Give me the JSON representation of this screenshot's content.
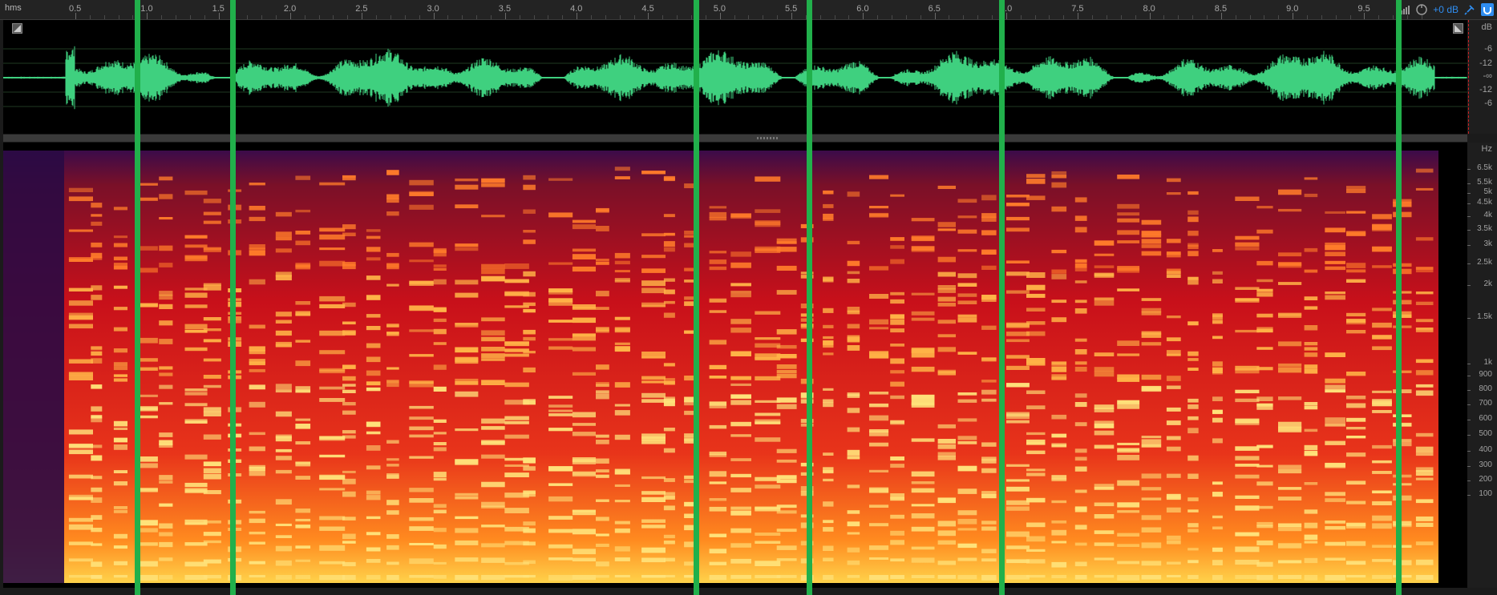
{
  "ruler": {
    "unit": "hms",
    "labels": [
      "0.5",
      "1.0",
      "1.5",
      "2.0",
      "2.5",
      "3.0",
      "3.5",
      "4.0",
      "4.5",
      "5.0",
      "5.5",
      "6.0",
      "6.5",
      "7.0",
      "7.5",
      "8.0",
      "8.5",
      "9.0",
      "9.5"
    ],
    "gain_label": "+0 dB"
  },
  "amplitude_scale": {
    "unit": "dB",
    "labels": [
      "-6",
      "-12",
      "-∞",
      "-12",
      "-6"
    ]
  },
  "frequency_scale": {
    "unit": "Hz",
    "labels": [
      "6.5k",
      "5.5k",
      "5k",
      "4.5k",
      "4k",
      "3.5k",
      "3k",
      "2.5k",
      "2k",
      "1.5k",
      "1k",
      "900",
      "800",
      "700",
      "600",
      "500",
      "400",
      "300",
      "200",
      "100"
    ]
  },
  "colors": {
    "waveform": "#3fd07f",
    "marker": "#21b04b",
    "accent": "#2f8df0",
    "clip": "#d02020"
  },
  "icons": {
    "waveform_toggle": "display-toggle-icon",
    "spectral_toggle": "spectral-toggle-icon",
    "level_meter": "level-meter-icon",
    "gain_knob": "gain-knob-icon",
    "pin": "pin-icon",
    "snap": "snap-icon"
  }
}
